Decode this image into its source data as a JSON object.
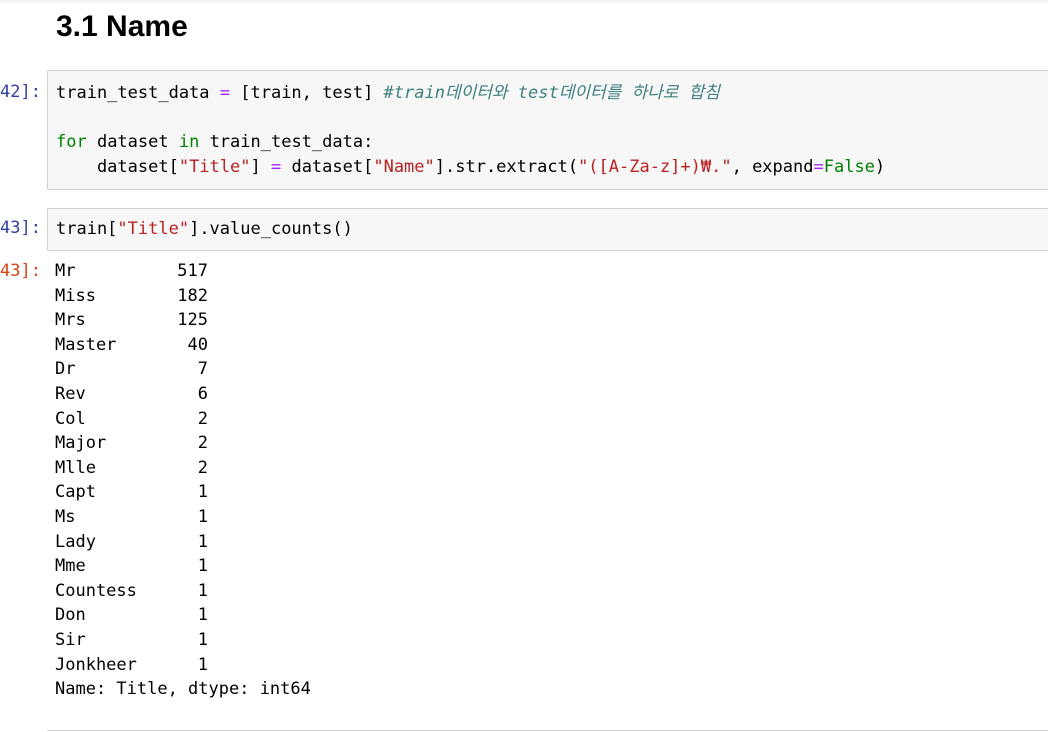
{
  "heading": "3.1 Name",
  "cells": [
    {
      "prompt": "42]:",
      "code": [
        [
          {
            "t": "train_test_data ",
            "c": ""
          },
          {
            "t": "=",
            "c": "op"
          },
          {
            "t": " [train, test] ",
            "c": ""
          },
          {
            "t": "#train데이터와 test데이터를 하나로 합침",
            "c": "cm"
          }
        ],
        [],
        [
          {
            "t": "for",
            "c": "kw"
          },
          {
            "t": " dataset ",
            "c": ""
          },
          {
            "t": "in",
            "c": "kw"
          },
          {
            "t": " train_test_data:",
            "c": ""
          }
        ],
        [
          {
            "t": "    dataset[",
            "c": ""
          },
          {
            "t": "\"Title\"",
            "c": "str"
          },
          {
            "t": "] ",
            "c": ""
          },
          {
            "t": "=",
            "c": "op"
          },
          {
            "t": " dataset[",
            "c": ""
          },
          {
            "t": "\"Name\"",
            "c": "str"
          },
          {
            "t": "].str.extract(",
            "c": ""
          },
          {
            "t": "\"([A-Za-z]+)₩.\"",
            "c": "str"
          },
          {
            "t": ", expand",
            "c": ""
          },
          {
            "t": "=",
            "c": "op"
          },
          {
            "t": "False",
            "c": "kw"
          },
          {
            "t": ")",
            "c": ""
          }
        ]
      ]
    },
    {
      "prompt": "43]:",
      "code": [
        [
          {
            "t": "train[",
            "c": ""
          },
          {
            "t": "\"Title\"",
            "c": "str"
          },
          {
            "t": "].value_counts()",
            "c": ""
          }
        ]
      ]
    }
  ],
  "output": {
    "prompt": "43]:",
    "rows": [
      {
        "label": "Mr",
        "value": "517"
      },
      {
        "label": "Miss",
        "value": "182"
      },
      {
        "label": "Mrs",
        "value": "125"
      },
      {
        "label": "Master",
        "value": "40"
      },
      {
        "label": "Dr",
        "value": "7"
      },
      {
        "label": "Rev",
        "value": "6"
      },
      {
        "label": "Col",
        "value": "2"
      },
      {
        "label": "Major",
        "value": "2"
      },
      {
        "label": "Mlle",
        "value": "2"
      },
      {
        "label": "Capt",
        "value": "1"
      },
      {
        "label": "Ms",
        "value": "1"
      },
      {
        "label": "Lady",
        "value": "1"
      },
      {
        "label": "Mme",
        "value": "1"
      },
      {
        "label": "Countess",
        "value": "1"
      },
      {
        "label": "Don",
        "value": "1"
      },
      {
        "label": "Sir",
        "value": "1"
      },
      {
        "label": "Jonkheer",
        "value": "1"
      }
    ],
    "footer": "Name: Title, dtype: int64"
  }
}
